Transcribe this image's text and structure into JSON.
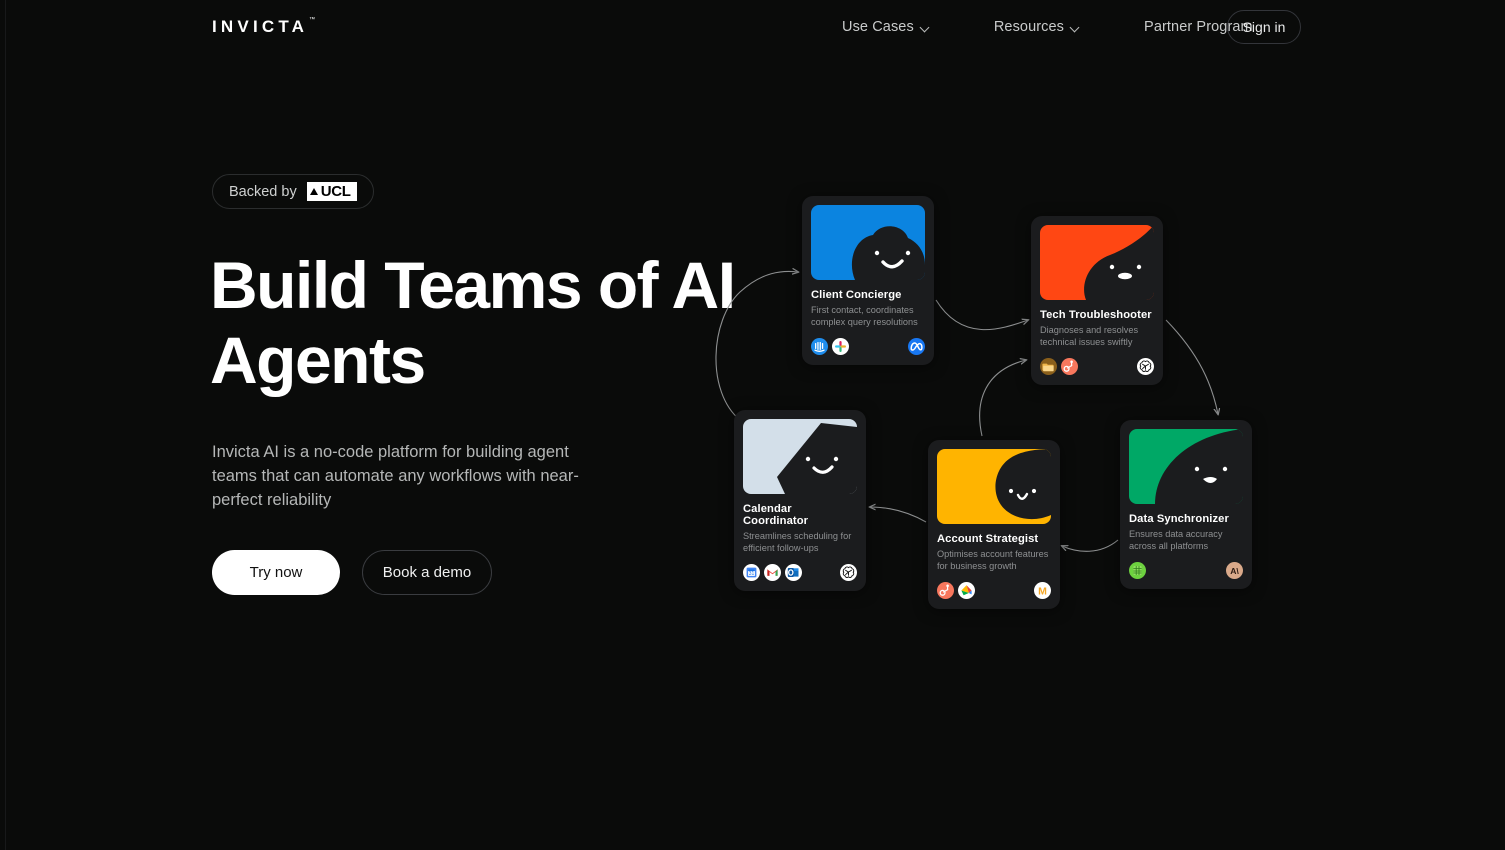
{
  "brand": {
    "name": "INVICTA",
    "trademark": "™"
  },
  "nav": {
    "items": [
      {
        "label": "Use Cases",
        "has_dropdown": true,
        "icon": "chevron-down-icon"
      },
      {
        "label": "Resources",
        "has_dropdown": true,
        "icon": "chevron-down-icon"
      },
      {
        "label": "Partner Program",
        "has_dropdown": false
      }
    ],
    "signin_label": "Sign in"
  },
  "hero": {
    "badge": {
      "prefix": "Backed by",
      "logo_text": "UCL"
    },
    "headline": "Build Teams of AI Agents",
    "subtitle": "Invicta AI is a no-code platform for building agent teams that can automate any workflows with near-perfect reliability",
    "primary_cta": "Try now",
    "secondary_cta": "Book a demo"
  },
  "colors": {
    "background": "#0a0b0a",
    "card": "#1b1c1e",
    "text_primary": "#ffffff",
    "text_muted": "#8e9092",
    "accent_white": "#ffffff",
    "client_blue": "#0b84e0",
    "tech_orange": "#ff4713",
    "calendar_ice": "#d3dfe9",
    "account_yellow": "#ffb400",
    "data_green": "#00a866"
  },
  "agents": [
    {
      "name": "Client Concierge",
      "description": "First contact, coordinates complex query resolutions",
      "avatar_color": "#0b84e0",
      "integrations": [
        "intercom-icon",
        "slack-icon"
      ],
      "model": "meta-icon"
    },
    {
      "name": "Tech Troubleshooter",
      "description": "Diagnoses and resolves technical issues swiftly",
      "avatar_color": "#ff4713",
      "integrations": [
        "folder-icon",
        "hubspot-icon"
      ],
      "model": "openai-icon"
    },
    {
      "name": "Calendar Coordinator",
      "description": "Streamlines scheduling for efficient follow-ups",
      "avatar_color": "#d3dfe9",
      "integrations": [
        "google-calendar-icon",
        "gmail-icon",
        "outlook-icon"
      ],
      "model": "openai-icon"
    },
    {
      "name": "Account Strategist",
      "description": "Optimises account features for business growth",
      "avatar_color": "#ffb400",
      "integrations": [
        "hubspot-icon",
        "google-drive-icon"
      ],
      "model": "mistral-icon"
    },
    {
      "name": "Data Synchronizer",
      "description": "Ensures data accuracy across all platforms",
      "avatar_color": "#00a866",
      "integrations": [
        "sheets-icon"
      ],
      "model": "anthropic-icon"
    }
  ],
  "flow": {
    "connections": [
      {
        "from": "Client Concierge",
        "to": "Tech Troubleshooter"
      },
      {
        "from": "Tech Troubleshooter",
        "to": "Data Synchronizer"
      },
      {
        "from": "Data Synchronizer",
        "to": "Account Strategist"
      },
      {
        "from": "Account Strategist",
        "to": "Calendar Coordinator"
      },
      {
        "from": "Account Strategist",
        "to": "Tech Troubleshooter"
      },
      {
        "from": "Calendar Coordinator",
        "to": "Client Concierge"
      }
    ]
  }
}
